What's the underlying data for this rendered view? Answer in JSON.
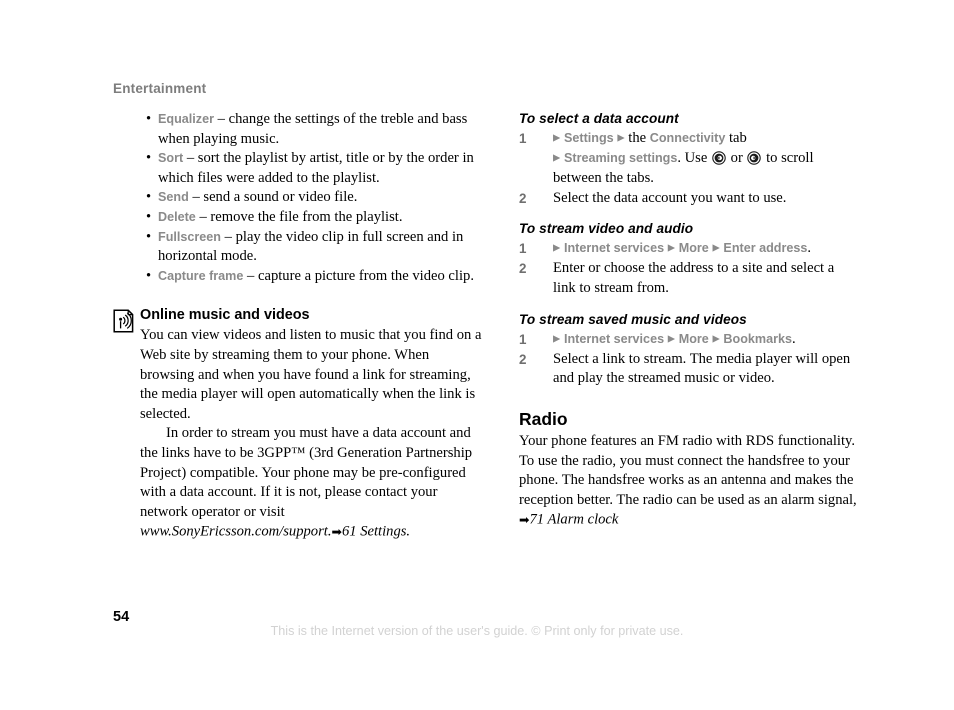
{
  "header": {
    "running_head": "Entertainment"
  },
  "left_column": {
    "bullets": [
      {
        "term": "Equalizer",
        "text": " – change the settings of the treble and bass when playing music."
      },
      {
        "term": "Sort",
        "text": " – sort the playlist by artist, title or by the order in which files were added to the playlist."
      },
      {
        "term": "Send",
        "text": " – send a sound or video file."
      },
      {
        "term": "Delete",
        "text": " – remove the file from the playlist."
      },
      {
        "term": "Fullscreen",
        "text": " – play the video clip in full screen and in horizontal mode."
      },
      {
        "term": "Capture frame",
        "text": " – capture a picture from the video clip."
      }
    ],
    "section": {
      "icon": "streaming-page-icon",
      "heading": "Online music and videos",
      "paragraph_1": "You can view videos and listen to music that you find on a Web site by streaming them to your phone. When browsing and when you have found a link for streaming, the media player will open automatically when the link is selected.",
      "paragraph_2_part1": "In order to stream you must have a data account and the links have to be 3GPP™ (3rd Generation Partnership Project) compatible. Your phone may be pre-configured with a data account. If it is not, please contact your network operator or visit ",
      "paragraph_2_url": "www.SonyEricsson.com/support.",
      "paragraph_2_arrow": "➡",
      "paragraph_2_ref": "61 Settings."
    }
  },
  "right_column": {
    "procedure_1": {
      "heading": "To select a data account",
      "steps": [
        {
          "number": "1",
          "tri_1": "▶",
          "kw_1": "Settings",
          "tri_2": "▶",
          "mid_1": " the ",
          "kw_2": "Connectivity",
          "mid_2": " tab",
          "tri_3": "▶",
          "kw_3": "Streaming settings",
          "mid_3": ". Use ",
          "mid_4": " or ",
          "mid_5": " to scroll between the tabs.",
          "icon_left": "nav-key-left-icon",
          "icon_right": "nav-key-right-icon"
        },
        {
          "number": "2",
          "text": "Select the data account you want to use."
        }
      ]
    },
    "procedure_2": {
      "heading": "To stream video and audio",
      "steps": [
        {
          "number": "1",
          "tri_1": "▶",
          "kw_1": "Internet services",
          "tri_2": "▶",
          "kw_2": "More",
          "tri_3": "▶",
          "kw_3": "Enter address",
          "tail": "."
        },
        {
          "number": "2",
          "text": "Enter or choose the address to a site and select a link to stream from."
        }
      ]
    },
    "procedure_3": {
      "heading": "To stream saved music and videos",
      "steps": [
        {
          "number": "1",
          "tri_1": "▶",
          "kw_1": "Internet services",
          "tri_2": "▶",
          "kw_2": "More",
          "tri_3": "▶",
          "kw_3": "Bookmarks",
          "tail": "."
        },
        {
          "number": "2",
          "text": "Select a link to stream. The media player will open and play the streamed music or video."
        }
      ]
    },
    "radio": {
      "heading": "Radio",
      "text_part1": "Your phone features an FM radio with RDS functionality. To use the radio, you must connect the handsfree to your phone. The handsfree works as an antenna and makes the reception better. The radio can be used as an alarm signal, ",
      "arrow": "➡",
      "ref": "71 Alarm clock"
    }
  },
  "footer": {
    "page_number": "54",
    "note": "This is the Internet version of the user's guide. © Print only for private use."
  }
}
